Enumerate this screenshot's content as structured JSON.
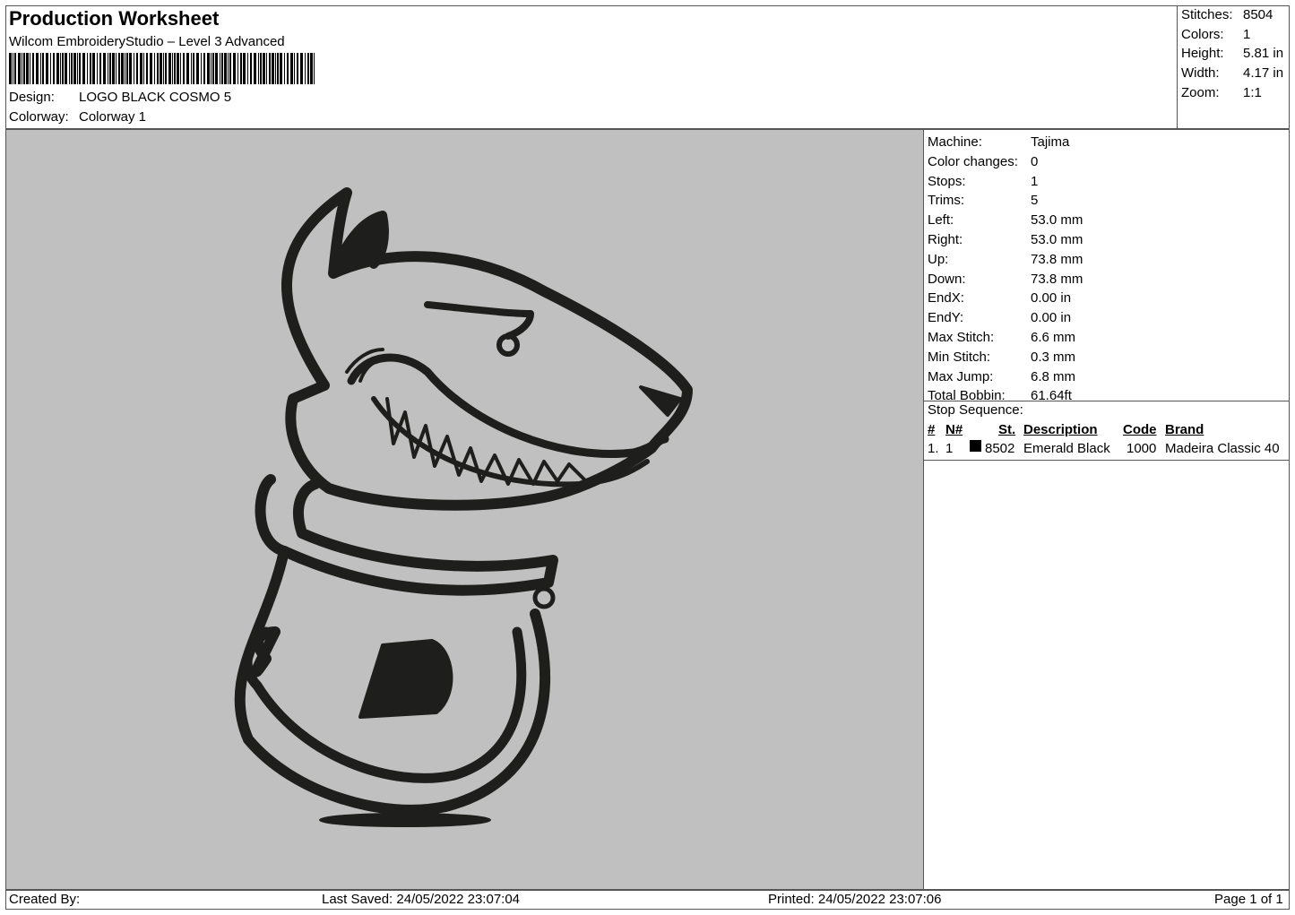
{
  "header": {
    "title": "Production Worksheet",
    "subtitle": "Wilcom EmbroideryStudio – Level 3 Advanced",
    "design_label": "Design:",
    "design_value": "LOGO BLACK COSMO 5",
    "colorway_label": "Colorway:",
    "colorway_value": "Colorway 1"
  },
  "stats": [
    {
      "label": "Stitches:",
      "value": "8504"
    },
    {
      "label": "Colors:",
      "value": "1"
    },
    {
      "label": "Height:",
      "value": "5.81 in"
    },
    {
      "label": "Width:",
      "value": "4.17 in"
    },
    {
      "label": "Zoom:",
      "value": "1:1"
    }
  ],
  "properties": [
    {
      "label": "Machine:",
      "value": "Tajima"
    },
    {
      "label": "Color changes:",
      "value": "0"
    },
    {
      "label": "Stops:",
      "value": "1"
    },
    {
      "label": "Trims:",
      "value": "5"
    },
    {
      "label": "Left:",
      "value": "53.0 mm"
    },
    {
      "label": "Right:",
      "value": "53.0 mm"
    },
    {
      "label": "Up:",
      "value": "73.8 mm"
    },
    {
      "label": "Down:",
      "value": "73.8 mm"
    },
    {
      "label": "EndX:",
      "value": "0.00 in"
    },
    {
      "label": "EndY:",
      "value": "0.00 in"
    },
    {
      "label": "Max Stitch:",
      "value": "6.6 mm"
    },
    {
      "label": "Min Stitch:",
      "value": "0.3 mm"
    },
    {
      "label": "Max Jump:",
      "value": "6.8 mm"
    },
    {
      "label": "Total Bobbin:",
      "value": "61.64ft"
    }
  ],
  "stop_sequence": {
    "title": "Stop Sequence:",
    "headers": {
      "num": "#",
      "n": "N#",
      "st": "St.",
      "description": "Description",
      "code": "Code",
      "brand": "Brand"
    },
    "rows": [
      {
        "num": "1.",
        "n": "1",
        "swatch_color": "#000000",
        "st": "8502",
        "description": "Emerald Black",
        "code": "1000",
        "brand": "Madeira Classic 40"
      }
    ]
  },
  "footer": {
    "created_by": "Created By:",
    "last_saved": "Last Saved: 24/05/2022 23:07:04",
    "printed": "Printed: 24/05/2022 23:07:06",
    "page": "Page 1 of 1"
  },
  "colors": {
    "canvas_background": "#c0c0c0",
    "thread": "#1e1e1c"
  }
}
